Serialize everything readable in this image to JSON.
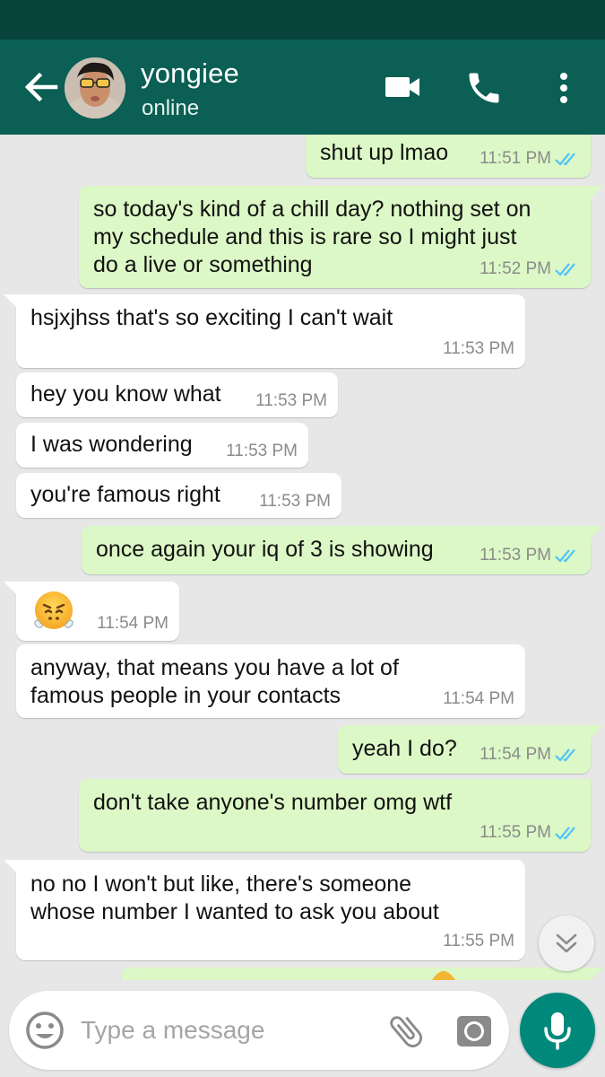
{
  "header": {
    "contact_name": "yongiee",
    "contact_status": "online",
    "colors": {
      "status_bar": "#08443c",
      "app_bar": "#0b5f54"
    }
  },
  "messages": [
    {
      "side": "out",
      "text": "shut up lmao",
      "time": "11:51 PM",
      "read": true
    },
    {
      "side": "out",
      "text": "so today's kind of a chill day? nothing set on\nmy schedule and this is rare so I might just\ndo a live or something",
      "time": "11:52 PM",
      "read": true
    },
    {
      "side": "in",
      "text": "hsjxjhss that's so exciting I can't wait",
      "time": "11:53 PM"
    },
    {
      "side": "in",
      "text": "hey you know what",
      "time": "11:53 PM"
    },
    {
      "side": "in",
      "text": "I was wondering",
      "time": "11:53 PM"
    },
    {
      "side": "in",
      "text": "you're famous right",
      "time": "11:53 PM"
    },
    {
      "side": "out",
      "text": "once again your iq of 3 is showing",
      "time": "11:53 PM",
      "read": true
    },
    {
      "side": "in",
      "text": "",
      "emoji": "face-with-steam-from-nose",
      "time": "11:54 PM"
    },
    {
      "side": "in",
      "text": "anyway, that means you have a lot of\nfamous people in your contacts",
      "time": "11:54 PM"
    },
    {
      "side": "out",
      "text": "yeah I do?",
      "time": "11:54 PM",
      "read": true
    },
    {
      "side": "out",
      "text": "don't take anyone's number omg wtf",
      "time": "11:55 PM",
      "read": true
    },
    {
      "side": "in",
      "text": "no no I won't but like, there's someone\nwhose number I wanted to ask you about",
      "time": "11:55 PM"
    }
  ],
  "composer": {
    "placeholder": "Type a message"
  },
  "colors": {
    "chat_bg": "#e7e7e7",
    "bubble_out": "#dcf8c6",
    "bubble_in": "#ffffff",
    "read_tick": "#4fc3f7",
    "mic_button": "#00897b"
  }
}
